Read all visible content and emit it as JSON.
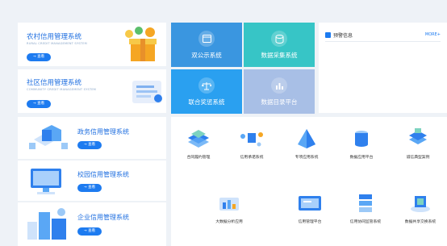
{
  "cards": [
    {
      "title": "农村信用管理系统",
      "subtitle": "RURAL CREDIT MANAGEMENT SYSTEM",
      "button": "查看"
    },
    {
      "title": "社区信用管理系统",
      "subtitle": "COMMUNITY CREDIT MANAGEMENT SYSTEM",
      "button": "查看"
    }
  ],
  "tiles": [
    {
      "label": "双公示系统",
      "icon": "window-icon",
      "color": "#3a96e0"
    },
    {
      "label": "数据采集系统",
      "icon": "database-icon",
      "color": "#37c5c6"
    },
    {
      "label": "联合奖惩系统",
      "icon": "scale-icon",
      "color": "#2aa0f0"
    },
    {
      "label": "数据目录平台",
      "icon": "bar-chart-icon",
      "color": "#a8bfe6"
    }
  ],
  "alert": {
    "title": "预警信息",
    "more": "MORE+"
  },
  "systems": [
    {
      "title": "政务信用管理系统",
      "button": "查看"
    },
    {
      "title": "校园信用管理系统",
      "button": "查看"
    },
    {
      "title": "企业信用管理系统",
      "button": "查看"
    }
  ],
  "grid_row1": [
    "合同履约管理",
    "信用承诺系统",
    "专项应用系统",
    "数据应用平台",
    "诚信典型案例"
  ],
  "grid_row2": [
    "大数据分析应用",
    "信用管理平台",
    "信用协同监管系统",
    "数据共享交换系统"
  ]
}
